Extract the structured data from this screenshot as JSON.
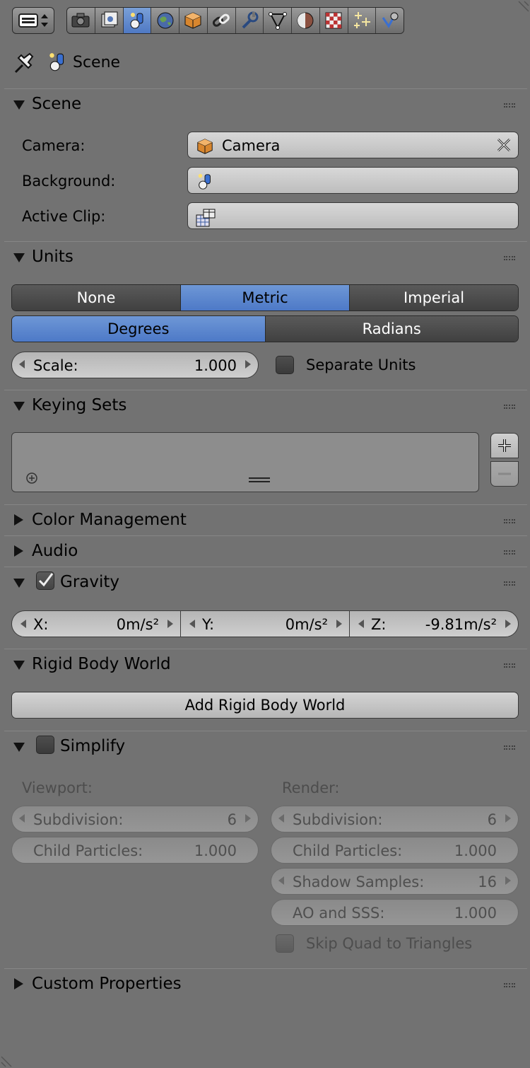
{
  "toolbar": {
    "tabs": [
      {
        "name": "render-tab",
        "icon": "camera-icon"
      },
      {
        "name": "render-layers-tab",
        "icon": "render-layers-icon"
      },
      {
        "name": "scene-tab",
        "icon": "scene-icon",
        "active": true
      },
      {
        "name": "world-tab",
        "icon": "world-icon"
      },
      {
        "name": "object-tab",
        "icon": "cube-icon"
      },
      {
        "name": "constraints-tab",
        "icon": "link-icon"
      },
      {
        "name": "modifiers-tab",
        "icon": "wrench-icon"
      },
      {
        "name": "data-tab",
        "icon": "vertex-icon"
      },
      {
        "name": "material-tab",
        "icon": "material-sphere-icon"
      },
      {
        "name": "texture-tab",
        "icon": "checker-icon"
      },
      {
        "name": "particles-tab",
        "icon": "particles-icon"
      },
      {
        "name": "physics-tab",
        "icon": "physics-icon"
      }
    ]
  },
  "context": {
    "label": "Scene"
  },
  "scene_panel": {
    "title": "Scene",
    "camera_label": "Camera:",
    "camera_value": "Camera",
    "background_label": "Background:",
    "active_clip_label": "Active Clip:"
  },
  "units_panel": {
    "title": "Units",
    "systems": [
      "None",
      "Metric",
      "Imperial"
    ],
    "rotation": [
      "Degrees",
      "Radians"
    ],
    "scale_label": "Scale:",
    "scale_value": "1.000",
    "separate_units": "Separate Units"
  },
  "keying_panel": {
    "title": "Keying Sets",
    "add": "+",
    "remove": "−"
  },
  "color_management_panel": {
    "title": "Color Management"
  },
  "audio_panel": {
    "title": "Audio"
  },
  "gravity_panel": {
    "title": "Gravity",
    "x_label": "X:",
    "x_value": "0m/s²",
    "y_label": "Y:",
    "y_value": "0m/s²",
    "z_label": "Z:",
    "z_value": "-9.81m/s²"
  },
  "rigid_body_panel": {
    "title": "Rigid Body World",
    "add_button": "Add Rigid Body World"
  },
  "simplify_panel": {
    "title": "Simplify",
    "viewport_label": "Viewport:",
    "render_label": "Render:",
    "vp_subdivision_label": "Subdivision:",
    "vp_subdivision_value": "6",
    "vp_child_label": "Child Particles:",
    "vp_child_value": "1.000",
    "r_subdivision_label": "Subdivision:",
    "r_subdivision_value": "6",
    "r_child_label": "Child Particles:",
    "r_child_value": "1.000",
    "r_shadow_label": "Shadow Samples:",
    "r_shadow_value": "16",
    "r_ao_label": "AO and SSS:",
    "r_ao_value": "1.000",
    "skip_quad": "Skip Quad to Triangles"
  },
  "custom_props_panel": {
    "title": "Custom Properties"
  }
}
